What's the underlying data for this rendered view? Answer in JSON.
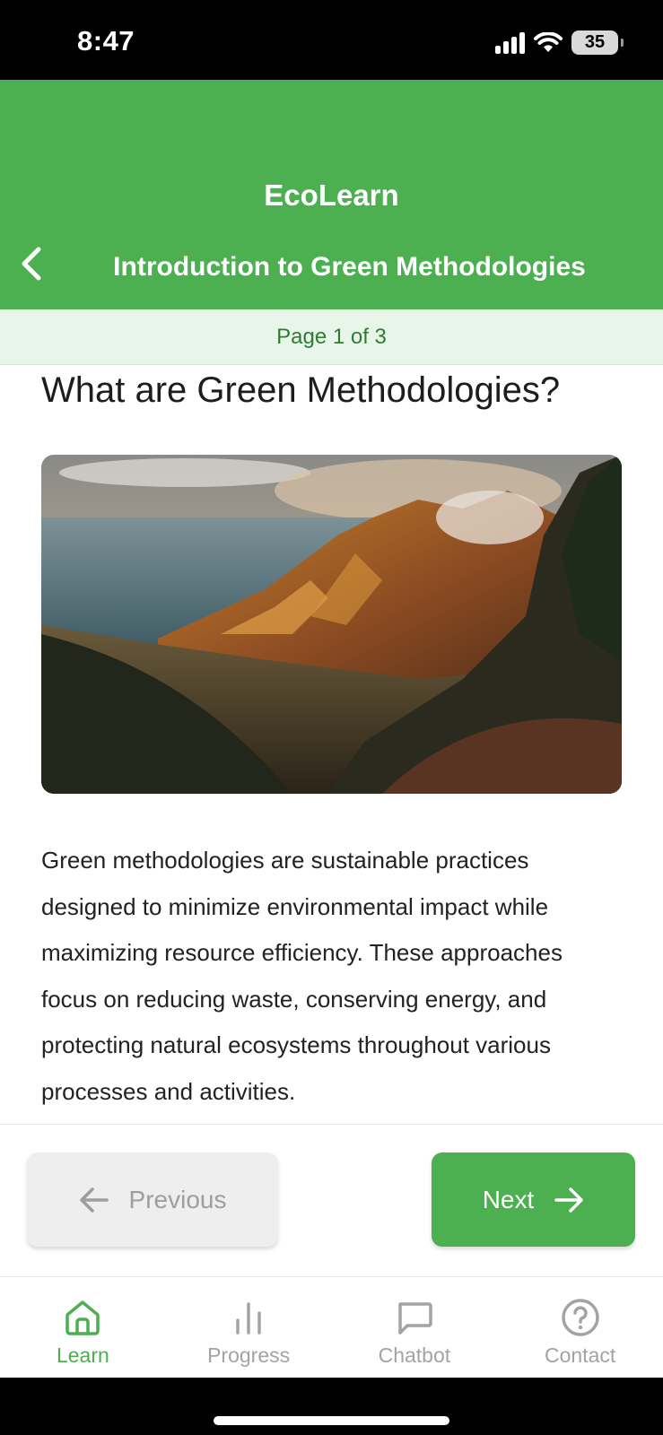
{
  "status_bar": {
    "time": "8:47",
    "battery": "35"
  },
  "header": {
    "app_title": "EcoLearn",
    "module_title": "Introduction to Green Methodologies"
  },
  "page_indicator": "Page 1 of 3",
  "lesson": {
    "heading": "What are Green Methodologies?",
    "image_icon": "mountain-landscape-photo",
    "body": "Green methodologies are sustainable practices designed to minimize environmental impact while maximizing resource efficiency. These approaches focus on reducing waste, conserving energy, and protecting natural ecosystems throughout various processes and activities."
  },
  "navigation": {
    "previous_label": "Previous",
    "next_label": "Next"
  },
  "tabs": [
    {
      "label": "Learn",
      "icon": "home-icon",
      "active": true
    },
    {
      "label": "Progress",
      "icon": "bar-chart-icon",
      "active": false
    },
    {
      "label": "Chatbot",
      "icon": "chat-bubble-icon",
      "active": false
    },
    {
      "label": "Contact",
      "icon": "help-circle-icon",
      "active": false
    }
  ],
  "colors": {
    "primary": "#4caf50",
    "primary_dark": "#2e7d32",
    "indicator_bg": "#e8f5e9",
    "inactive": "#a3a3a3"
  }
}
